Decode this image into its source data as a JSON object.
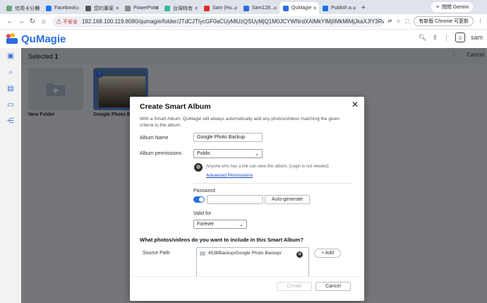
{
  "browser": {
    "tabs": [
      {
        "label": "信用卡分期"
      },
      {
        "label": "Facebook"
      },
      {
        "label": "您的專案"
      },
      {
        "label": "PowerPoint"
      },
      {
        "label": "台灣特有"
      },
      {
        "label": "Sam (Hu..."
      },
      {
        "label": "Sam128..."
      },
      {
        "label": "QuMagie"
      },
      {
        "label": "Publish a..."
      }
    ],
    "gemini_label": "問問 Gemini",
    "insecure_label": "不安全",
    "url": "192.168.100.119:8080/qumagie/folder/JTdCJTIycGF0aCUyMlUzQSUyMjQ1M0JCYWNrdXAlMkYlMjIlMkMlMjJkaXJlY3RvcnUlZCUyMlUzQSUyMlRHdE...",
    "update_label": "有新版 Chrome 可更新"
  },
  "app": {
    "name": "QuMagie",
    "user": "sam",
    "selected_label": "Selected",
    "selected_count": "1",
    "cancel_label": "Cancel",
    "folders": [
      {
        "name": "New Folder"
      },
      {
        "name": "Google Photo B"
      }
    ]
  },
  "dialog": {
    "title": "Create Smart Album",
    "description": "With a Smart Album, QuMagie will always automatically add any photos/videos matching the given criteria to the album.",
    "album_name_label": "Album Name",
    "album_name_value": "Google Photo Backup",
    "permissions_label": "Album permissions",
    "permissions_value": "Public",
    "public_note": "Anyone who has a link can view this album. (Login is not needed)",
    "advanced_link": "Advanced Permissions",
    "password_label": "Password",
    "password_value": "",
    "auto_generate": "Auto-generate",
    "valid_for_label": "Valid for",
    "valid_for_value": "Forever",
    "question": "What photos/videos do you want to include in this Smart Album?",
    "source_path_label": "Source Path",
    "source_path_value": "453BBackup/Google Photo Backup/",
    "add_label": "+ Add",
    "create_label": "Create",
    "cancel_label": "Cancel"
  }
}
